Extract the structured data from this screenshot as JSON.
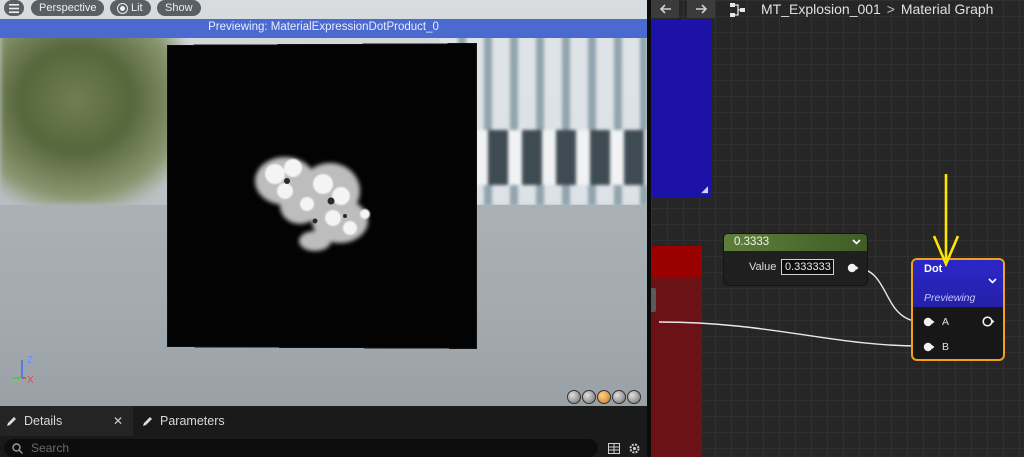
{
  "viewport": {
    "menu_icon": "hamburger-menu-icon",
    "view_mode": "Perspective",
    "lighting_mode": "Lit",
    "show_label": "Show",
    "preview_banner": "Previewing: MaterialExpressionDotProduct_0",
    "axis": {
      "z": "Z",
      "x": "X"
    },
    "preview_shapes": [
      "cylinder",
      "sphere",
      "plane",
      "cube",
      "custom-mesh"
    ]
  },
  "bottom_panel": {
    "tabs": [
      {
        "label": "Details",
        "icon": "pencil-icon",
        "closable": true
      },
      {
        "label": "Parameters",
        "icon": "pencil-icon",
        "closable": false
      }
    ],
    "close_glyph": "✕",
    "search_placeholder": "Search"
  },
  "graph": {
    "breadcrumb": {
      "asset": "MT_Explosion_001",
      "separator": ">",
      "graph": "Material Graph"
    },
    "constant_node": {
      "title": "0.3333",
      "value_label": "Value",
      "value": "0.333333"
    },
    "dot_node": {
      "title": "Dot",
      "status": "Previewing",
      "input_a": "A",
      "input_b": "B"
    },
    "annotation": {
      "type": "arrow",
      "color": "#ffe600"
    }
  },
  "colors": {
    "banner": "#4a6ad0",
    "selected_node_border": "#f2a21a",
    "dot_node_header": "#2b27c8",
    "constant_node_header": "#5e7f3a",
    "arrow": "#ffe600"
  }
}
